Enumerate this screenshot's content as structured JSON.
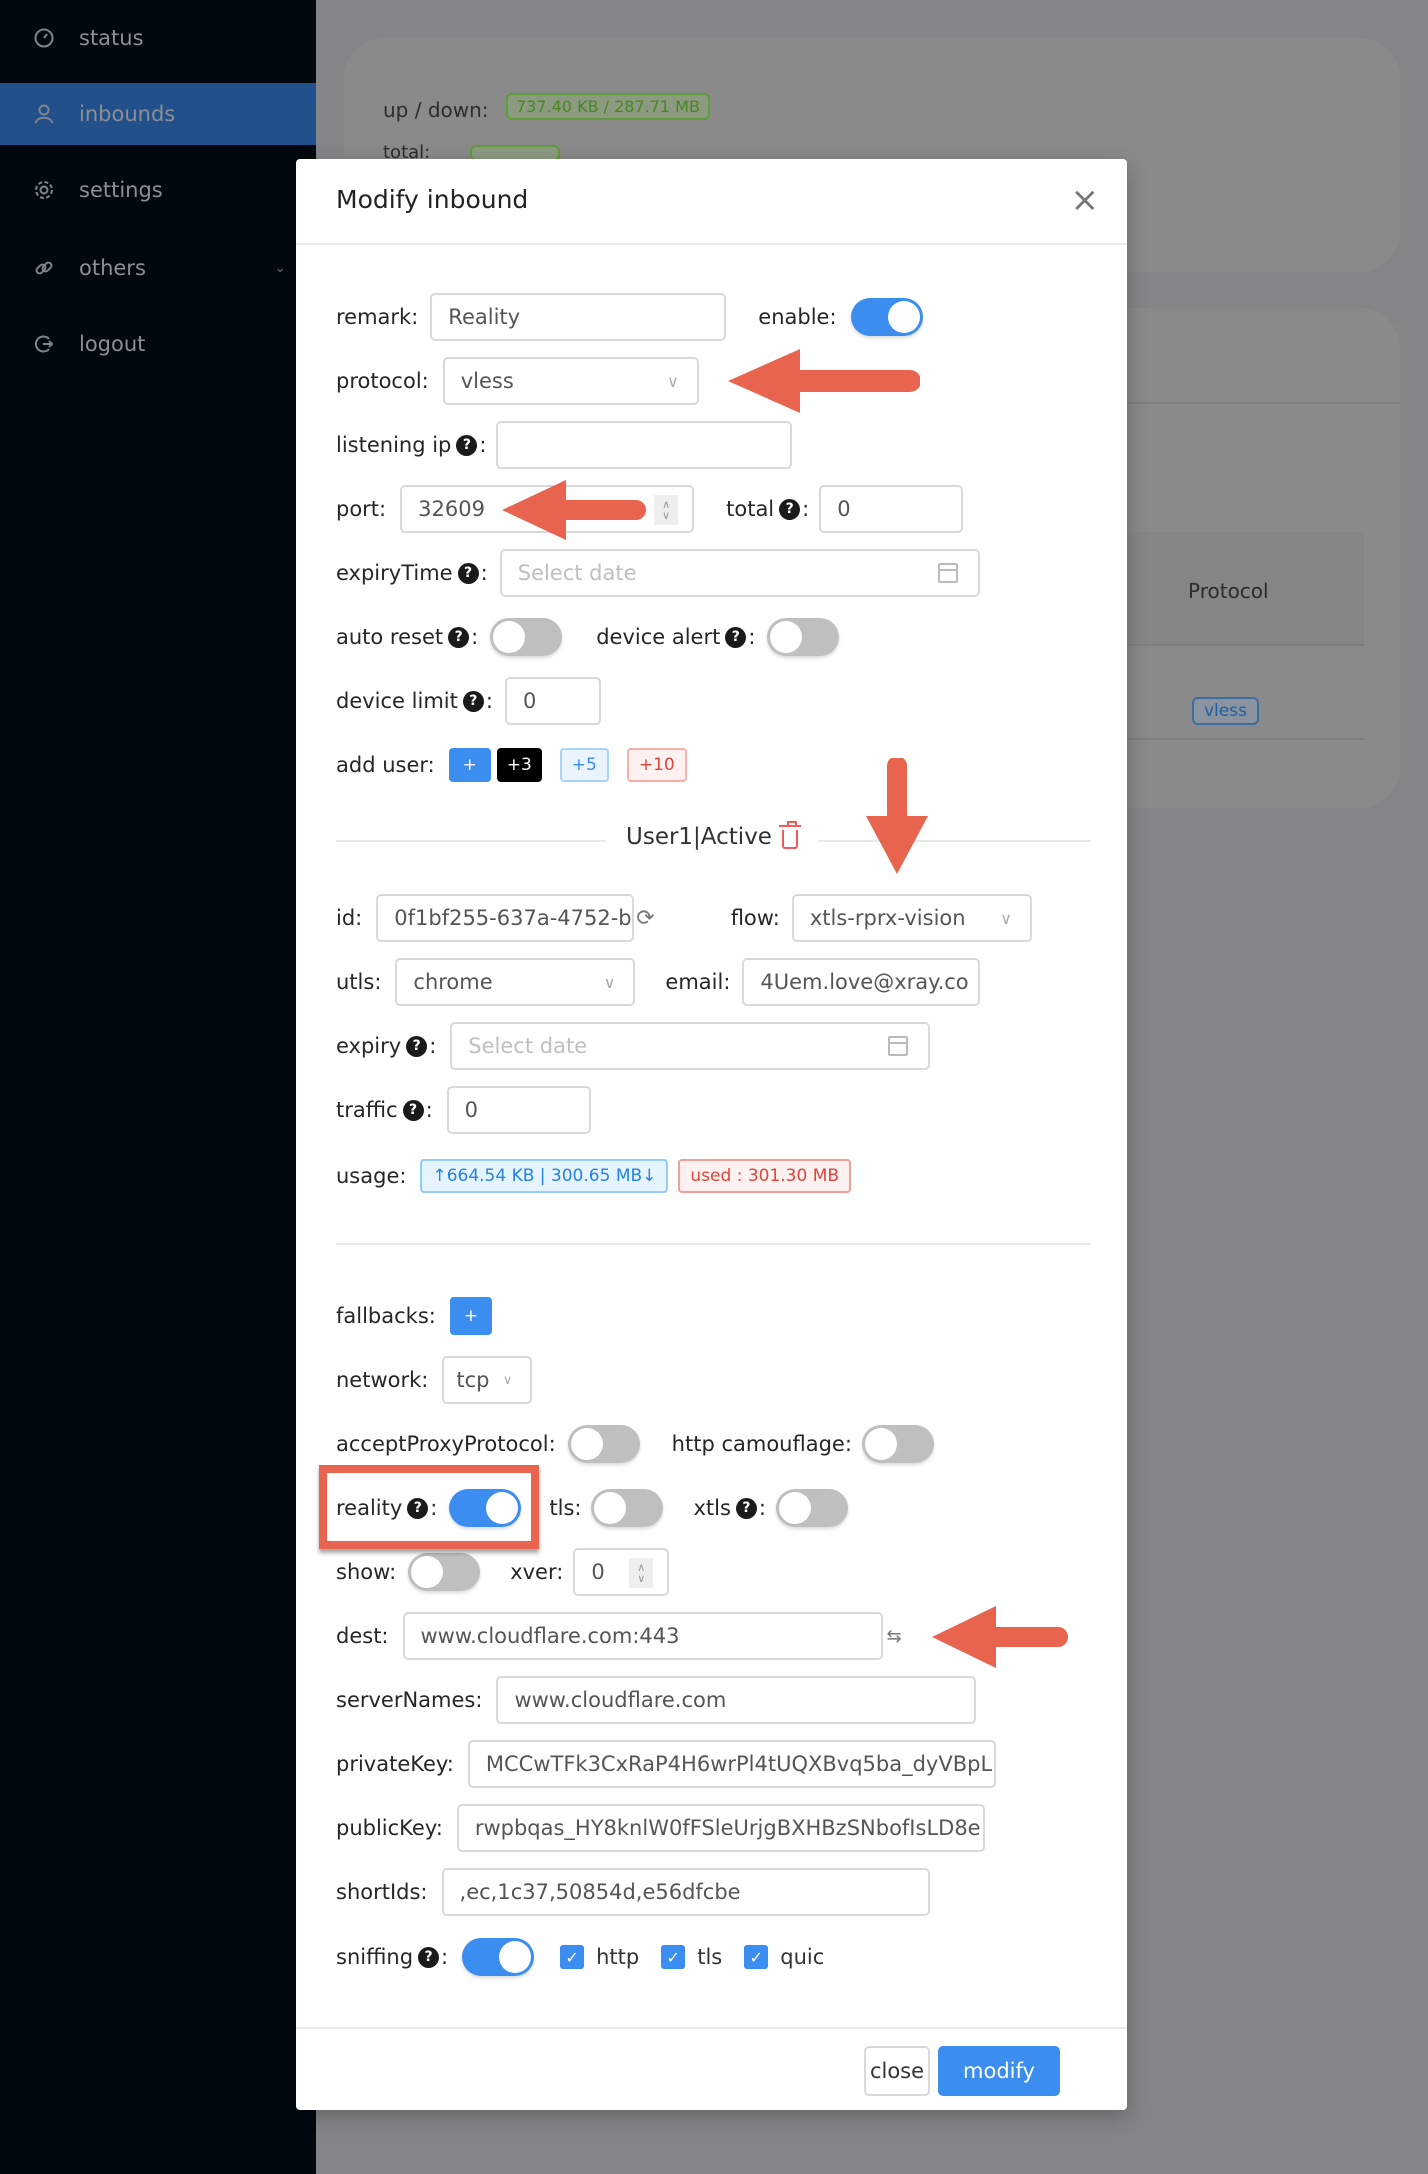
{
  "sidebar": {
    "items": [
      {
        "label": "status",
        "icon": "dashboard-icon",
        "active": false
      },
      {
        "label": "inbounds",
        "icon": "user-icon",
        "active": true
      },
      {
        "label": "settings",
        "icon": "gear-icon",
        "active": false
      },
      {
        "label": "others",
        "icon": "link-icon",
        "active": false,
        "expandable": true
      },
      {
        "label": "logout",
        "icon": "logout-icon",
        "active": false
      }
    ]
  },
  "background": {
    "updown_label": "up / down:",
    "updown_value": "737.40 KB / 287.71 MB",
    "total_label": "total:",
    "table_header_protocol": "Protocol",
    "row_protocol_tag": "vless"
  },
  "modal": {
    "title": "Modify inbound",
    "close_icon": "×",
    "remark": {
      "label": "remark:",
      "value": "Reality"
    },
    "enable": {
      "label": "enable:",
      "value": true
    },
    "protocol": {
      "label": "protocol:",
      "value": "vless"
    },
    "listening_ip": {
      "label": "listening ip",
      "value": ""
    },
    "port": {
      "label": "port:",
      "value": "32609"
    },
    "total": {
      "label": "total",
      "value": "0"
    },
    "expiry_time": {
      "label": "expiryTime",
      "placeholder": "Select date"
    },
    "auto_reset": {
      "label": "auto reset",
      "value": false
    },
    "device_alert": {
      "label": "device alert",
      "value": false
    },
    "device_limit": {
      "label": "device limit",
      "value": "0"
    },
    "add_user": {
      "label": "add user:",
      "buttons": [
        "+",
        "+3",
        "+5",
        "+10"
      ]
    },
    "user_section": {
      "title": "User1|Active",
      "id": {
        "label": "id:",
        "value": "0f1bf255-637a-4752-b"
      },
      "flow": {
        "label": "flow:",
        "value": "xtls-rprx-vision"
      },
      "utls": {
        "label": "utls:",
        "value": "chrome"
      },
      "email": {
        "label": "email:",
        "value": "4Uem.love@xray.co"
      },
      "expiry": {
        "label": "expiry",
        "placeholder": "Select date"
      },
      "traffic": {
        "label": "traffic",
        "value": "0"
      },
      "usage": {
        "label": "usage:",
        "updown": "↑664.54 KB | 300.65 MB↓",
        "used": "used : 301.30 MB"
      }
    },
    "fallbacks": {
      "label": "fallbacks:",
      "button": "+"
    },
    "network": {
      "label": "network:",
      "value": "tcp"
    },
    "accept_proxy_protocol": {
      "label": "acceptProxyProtocol:",
      "value": false
    },
    "http_camouflage": {
      "label": "http camouflage:",
      "value": false
    },
    "reality": {
      "label": "reality",
      "value": true
    },
    "tls": {
      "label": "tls:",
      "value": false
    },
    "xtls": {
      "label": "xtls",
      "value": false
    },
    "show": {
      "label": "show:",
      "value": false
    },
    "xver": {
      "label": "xver:",
      "value": "0"
    },
    "dest": {
      "label": "dest:",
      "value": "www.cloudflare.com:443"
    },
    "server_names": {
      "label": "serverNames:",
      "value": "www.cloudflare.com"
    },
    "private_key": {
      "label": "privateKey:",
      "value": "MCCwTFk3CxRaP4H6wrPl4tUQXBvq5ba_dyVBpL("
    },
    "public_key": {
      "label": "publicKey:",
      "value": "rwpbqas_HY8knlW0fFSleUrjgBXHBzSNbofIsLD8e"
    },
    "short_ids": {
      "label": "shortIds:",
      "value": ",ec,1c37,50854d,e56dfcbe"
    },
    "sniffing": {
      "label": "sniffing",
      "value": true,
      "options": [
        {
          "label": "http",
          "checked": true
        },
        {
          "label": "tls",
          "checked": true
        },
        {
          "label": "quic",
          "checked": true
        }
      ]
    },
    "footer": {
      "close_label": "close",
      "modify_label": "modify"
    }
  },
  "colors": {
    "primary": "#3b8df0",
    "sidebar_bg": "#020810",
    "sidebar_active": "#21508a",
    "annotation": "#e8644f"
  }
}
